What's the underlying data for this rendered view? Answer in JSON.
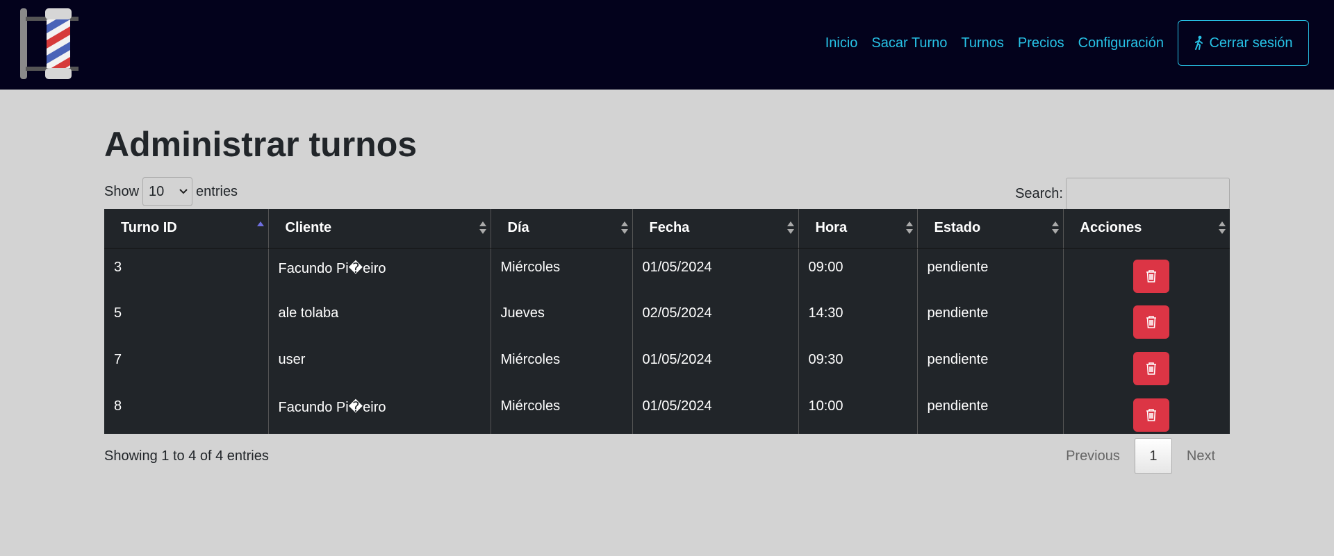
{
  "nav": {
    "links": [
      "Inicio",
      "Sacar Turno",
      "Turnos",
      "Precios",
      "Configuración"
    ],
    "logout_label": "Cerrar sesión"
  },
  "page": {
    "title": "Administrar turnos"
  },
  "controls": {
    "show_label": "Show",
    "entries_label": "entries",
    "page_length": "10",
    "search_label": "Search:",
    "search_value": ""
  },
  "table": {
    "columns": [
      "Turno ID",
      "Cliente",
      "Día",
      "Fecha",
      "Hora",
      "Estado",
      "Acciones"
    ],
    "rows": [
      [
        "3",
        "Facundo Pi�eiro",
        "Miércoles",
        "01/05/2024",
        "09:00",
        "pendiente"
      ],
      [
        "5",
        "ale tolaba",
        "Jueves",
        "02/05/2024",
        "14:30",
        "pendiente"
      ],
      [
        "7",
        "user",
        "Miércoles",
        "01/05/2024",
        "09:30",
        "pendiente"
      ],
      [
        "8",
        "Facundo Pi�eiro",
        "Miércoles",
        "01/05/2024",
        "10:00",
        "pendiente"
      ]
    ]
  },
  "footer": {
    "info": "Showing 1 to 4 of 4 entries",
    "previous": "Previous",
    "current_page": "1",
    "next": "Next"
  },
  "colors": {
    "navbar_bg": "#03021c",
    "accent": "#27c2e6",
    "danger": "#dc3545",
    "table_bg": "#212529"
  }
}
